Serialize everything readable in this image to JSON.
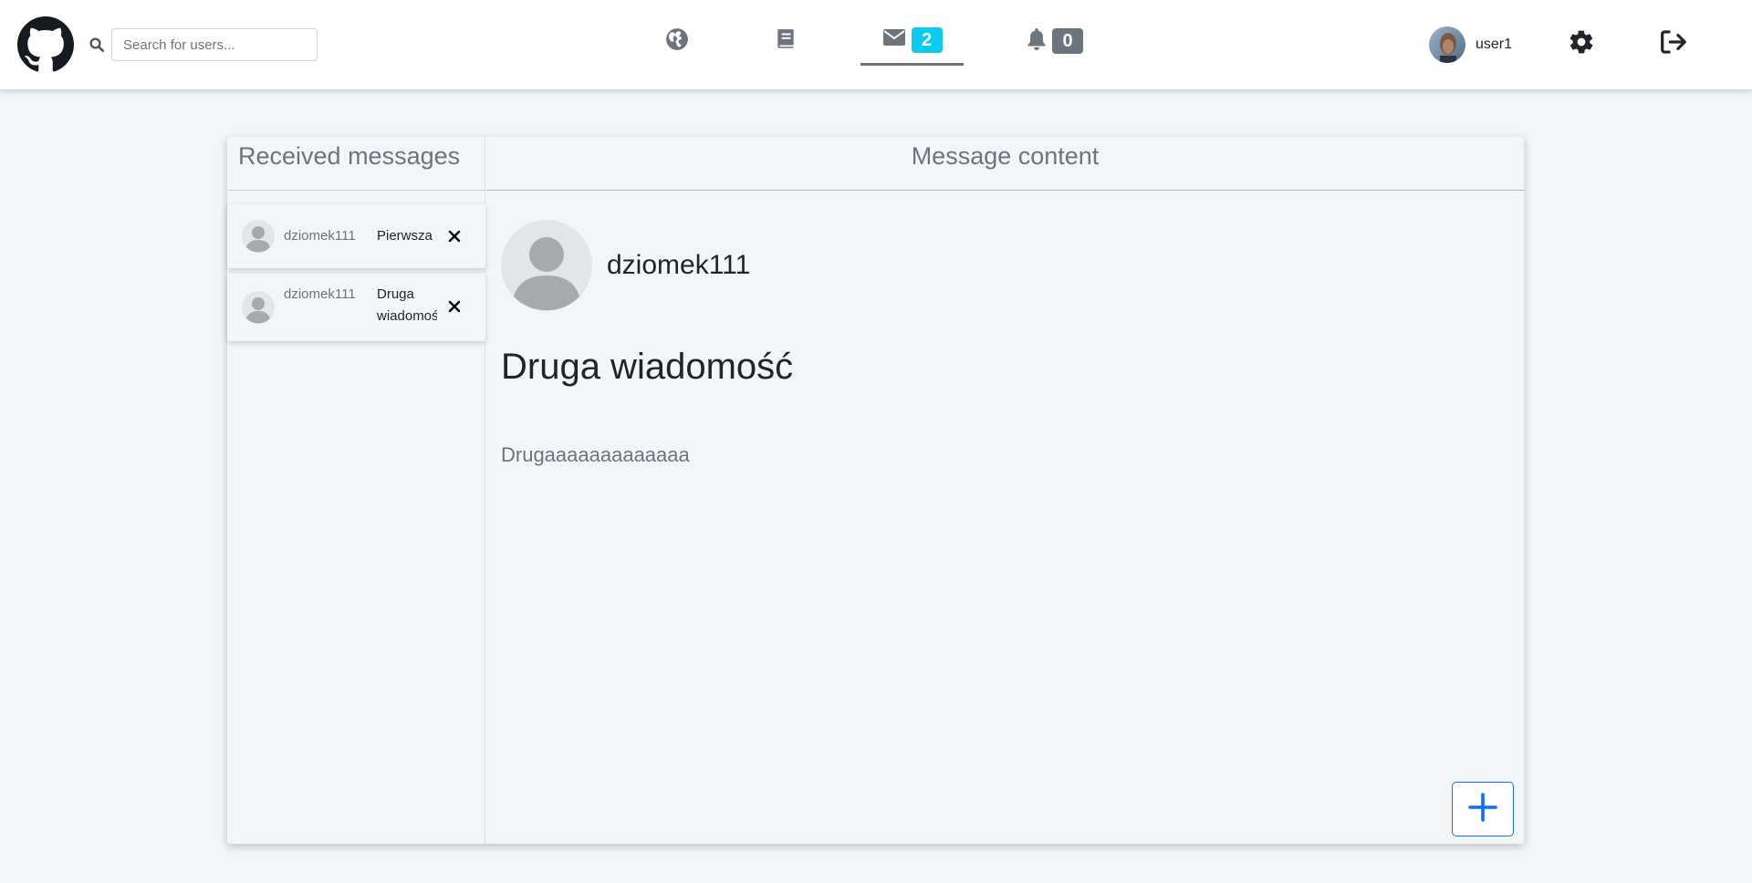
{
  "header": {
    "search": {
      "placeholder": "Search for users...",
      "value": ""
    },
    "nav": {
      "home_icon": "globe-icon",
      "posts_icon": "book-icon",
      "messages_icon": "envelope-icon",
      "messages_count": "2",
      "notifications_icon": "bell-icon",
      "notifications_count": "0"
    },
    "user": {
      "name": "user1"
    },
    "settings_icon": "gear-icon",
    "logout_icon": "sign-out-icon"
  },
  "inbox": {
    "title": "Received messages",
    "messages": [
      {
        "sender": "dziomek111",
        "subject": "Pierwsza"
      },
      {
        "sender": "dziomek111",
        "subject": "Druga wiadomość"
      }
    ]
  },
  "content": {
    "title": "Message content",
    "sender": "dziomek111",
    "subject": "Druga wiadomość",
    "body": "Drugaaaaaaaaaaaaa"
  },
  "colors": {
    "accent": "#0d6efd",
    "messages_badge": "#0dcaf0",
    "notifications_badge": "#6c757d",
    "background": "#f3f6f9"
  }
}
